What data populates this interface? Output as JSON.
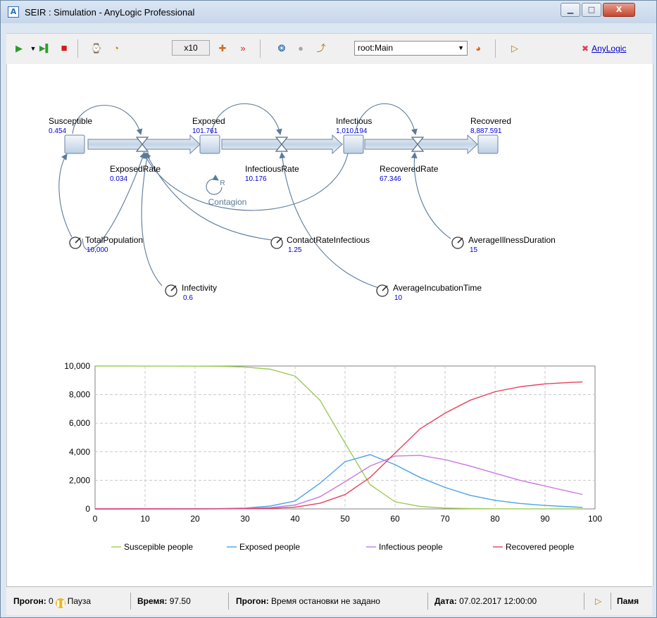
{
  "window": {
    "title": "SEIR : Simulation - AnyLogic Professional",
    "controls": {
      "minimize": "▁",
      "maximize": "□",
      "close": "X"
    }
  },
  "toolbar": {
    "speed_label": "x10",
    "experiment_select": {
      "value": "root:Main"
    },
    "brand_label": "AnyLogic"
  },
  "model": {
    "stocks": [
      {
        "name": "Susceptible",
        "value": "0.454"
      },
      {
        "name": "Exposed",
        "value": "101.761"
      },
      {
        "name": "Infectious",
        "value": "1,010.194"
      },
      {
        "name": "Recovered",
        "value": "8,887.591"
      }
    ],
    "flows": [
      {
        "name": "ExposedRate",
        "value": "0.034"
      },
      {
        "name": "InfectiousRate",
        "value": "10.176"
      },
      {
        "name": "RecoveredRate",
        "value": "67.346"
      }
    ],
    "parameters": [
      {
        "name": "TotalPopulation",
        "value": "10,000"
      },
      {
        "name": "ContactRateInfectious",
        "value": "1.25"
      },
      {
        "name": "AverageIllnessDuration",
        "value": "15"
      },
      {
        "name": "Infectivity",
        "value": "0.6"
      },
      {
        "name": "AverageIncubationTime",
        "value": "10"
      }
    ],
    "loop": {
      "symbol": "R",
      "label": "Contagion"
    }
  },
  "chart_data": {
    "type": "line",
    "xlim": [
      0,
      100
    ],
    "ylim": [
      0,
      10000
    ],
    "x_ticks": [
      "0",
      "10",
      "20",
      "30",
      "40",
      "50",
      "60",
      "70",
      "80",
      "90",
      "100"
    ],
    "y_ticks": [
      "0",
      "2,000",
      "4,000",
      "6,000",
      "8,000",
      "10,000"
    ],
    "grid": true,
    "legend_position": "bottom",
    "x": [
      0,
      5,
      10,
      15,
      20,
      25,
      30,
      35,
      40,
      45,
      50,
      55,
      60,
      65,
      70,
      75,
      80,
      85,
      90,
      95,
      97.5
    ],
    "series": [
      {
        "name": "Suscepible people",
        "color": "#9ccc55",
        "values": [
          9999,
          9998,
          9997,
          9995,
          9990,
          9975,
          9930,
          9780,
          9300,
          7600,
          4600,
          1700,
          500,
          170,
          60,
          25,
          12,
          6,
          3,
          1,
          0.5
        ]
      },
      {
        "name": "Exposed people",
        "color": "#4aa3ea",
        "values": [
          0,
          1,
          3,
          6,
          10,
          20,
          60,
          200,
          550,
          1800,
          3300,
          3800,
          3100,
          2200,
          1500,
          950,
          600,
          380,
          240,
          150,
          102
        ]
      },
      {
        "name": "Infectious people",
        "color": "#cc77e0",
        "values": [
          0,
          0,
          1,
          3,
          6,
          12,
          30,
          90,
          270,
          850,
          1900,
          3000,
          3700,
          3750,
          3450,
          3000,
          2500,
          2000,
          1600,
          1200,
          1010
        ]
      },
      {
        "name": "Recovered people",
        "color": "#e84060",
        "values": [
          0,
          0,
          0,
          1,
          2,
          5,
          12,
          40,
          120,
          400,
          1000,
          2200,
          3900,
          5600,
          6700,
          7600,
          8200,
          8550,
          8750,
          8850,
          8888
        ]
      }
    ]
  },
  "status": {
    "run_label": "Прогон:",
    "run_value": "0",
    "state": "Пауза",
    "time_label": "Время:",
    "time_value": "97.50",
    "stop_label": "Прогон:",
    "stop_value": "Время остановки не задано",
    "date_label": "Дата:",
    "date_value": "07.02.2017 12:00:00",
    "memory_label": "Памя"
  }
}
